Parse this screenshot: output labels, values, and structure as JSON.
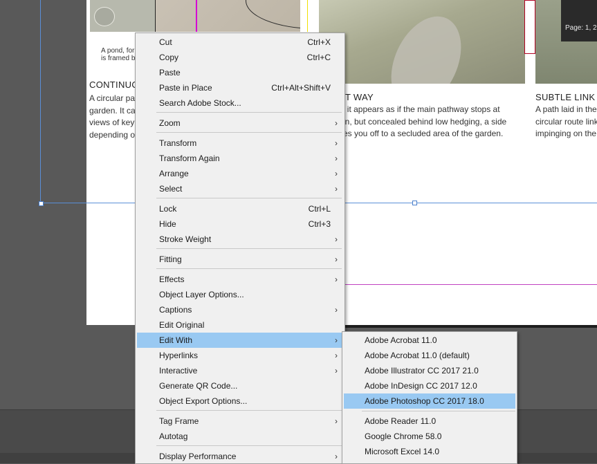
{
  "document": {
    "caption_pond": "A pond, for\nis framed b",
    "heading_left": "CONTINUO",
    "body_left": [
      "A circular pa",
      "garden. It ca",
      "views of key",
      "depending o"
    ],
    "heading_mid": "ET WAY",
    "body_mid": [
      "y, it appears as if the main pathway stops at",
      "wn, but concealed behind low hedging, a side",
      "kes you off to a secluded area of the garden."
    ],
    "heading_right": "SUBTLE LINK",
    "body_right": [
      "A path laid in the",
      "circular route link",
      "impinging on the"
    ],
    "page_badge": "Page: 1, 2"
  },
  "context_menu": {
    "items": [
      {
        "label": "Cut",
        "shortcut": "Ctrl+X"
      },
      {
        "label": "Copy",
        "shortcut": "Ctrl+C"
      },
      {
        "label": "Paste",
        "shortcut": ""
      },
      {
        "label": "Paste in Place",
        "shortcut": "Ctrl+Alt+Shift+V"
      },
      {
        "label": "Search Adobe Stock...",
        "shortcut": ""
      },
      {
        "label": "Zoom",
        "shortcut": ""
      },
      {
        "label": "Transform",
        "shortcut": ""
      },
      {
        "label": "Transform Again",
        "shortcut": ""
      },
      {
        "label": "Arrange",
        "shortcut": ""
      },
      {
        "label": "Select",
        "shortcut": ""
      },
      {
        "label": "Lock",
        "shortcut": "Ctrl+L"
      },
      {
        "label": "Hide",
        "shortcut": "Ctrl+3"
      },
      {
        "label": "Stroke Weight",
        "shortcut": ""
      },
      {
        "label": "Fitting",
        "shortcut": ""
      },
      {
        "label": "Effects",
        "shortcut": ""
      },
      {
        "label": "Object Layer Options...",
        "shortcut": ""
      },
      {
        "label": "Captions",
        "shortcut": ""
      },
      {
        "label": "Edit Original",
        "shortcut": ""
      },
      {
        "label": "Edit With",
        "shortcut": ""
      },
      {
        "label": "Hyperlinks",
        "shortcut": ""
      },
      {
        "label": "Interactive",
        "shortcut": ""
      },
      {
        "label": "Generate QR Code...",
        "shortcut": ""
      },
      {
        "label": "Object Export Options...",
        "shortcut": ""
      },
      {
        "label": "Tag Frame",
        "shortcut": ""
      },
      {
        "label": "Autotag",
        "shortcut": ""
      },
      {
        "label": "Display Performance",
        "shortcut": ""
      }
    ],
    "submenu_arrow": "›"
  },
  "edit_with_submenu": {
    "items": [
      {
        "label": "Adobe Acrobat 11.0"
      },
      {
        "label": "Adobe Acrobat  11.0 (default)"
      },
      {
        "label": "Adobe Illustrator CC 2017 21.0"
      },
      {
        "label": "Adobe InDesign CC 2017 12.0"
      },
      {
        "label": "Adobe Photoshop CC 2017 18.0"
      },
      {
        "label": "Adobe Reader  11.0"
      },
      {
        "label": "Google Chrome 58.0"
      },
      {
        "label": "Microsoft Excel 14.0"
      }
    ]
  },
  "colors": {
    "highlight": "#99c9f2",
    "selection_frame": "#5a8fd8",
    "guide_magenta": "#d400d4"
  }
}
